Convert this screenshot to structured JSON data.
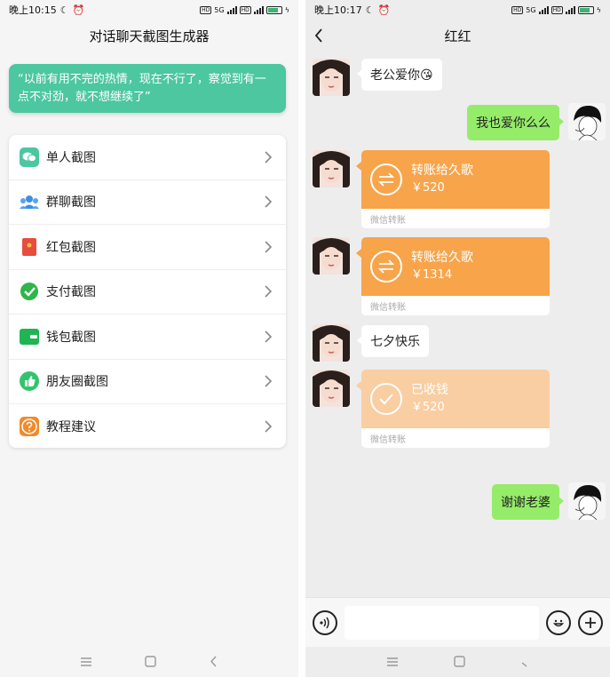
{
  "left": {
    "status": {
      "time": "晚上10:15",
      "net": "5G"
    },
    "title": "对话聊天截图生成器",
    "quote": "“以前有用不完的热情，现在不行了，察觉到有一点不对劲，就不想继续了”",
    "menu": [
      {
        "label": "单人截图",
        "icon": "chat-bubble-icon",
        "color": "#4cc7a0"
      },
      {
        "label": "群聊截图",
        "icon": "group-icon",
        "color": "#3d8fe0"
      },
      {
        "label": "红包截图",
        "icon": "red-packet-icon",
        "color": "#e84c3d"
      },
      {
        "label": "支付截图",
        "icon": "check-pay-icon",
        "color": "#2fb54a"
      },
      {
        "label": "钱包截图",
        "icon": "wallet-icon",
        "color": "#20b455"
      },
      {
        "label": "朋友圈截图",
        "icon": "thumbs-up-icon",
        "color": "#33c46b"
      },
      {
        "label": "教程建议",
        "icon": "question-icon",
        "color": "#f08a2c"
      }
    ]
  },
  "right": {
    "status": {
      "time": "晚上10:17",
      "net": "5G"
    },
    "chat_title": "红红",
    "messages": {
      "m1": "老公爱你😘",
      "m2": "我也爱你么么",
      "t1_title": "转账给久歌",
      "t1_amount": "￥520",
      "t1_footer": "微信转账",
      "t2_title": "转账给久歌",
      "t2_amount": "￥1314",
      "t2_footer": "微信转账",
      "m3": "七夕快乐",
      "t3_title": "已收钱",
      "t3_amount": "￥520",
      "t3_footer": "微信转账",
      "m4": "谢谢老婆"
    },
    "colors": {
      "transfer": "#f7a44b",
      "received": "#f8ceA2",
      "sent_bubble": "#95ec69"
    }
  }
}
